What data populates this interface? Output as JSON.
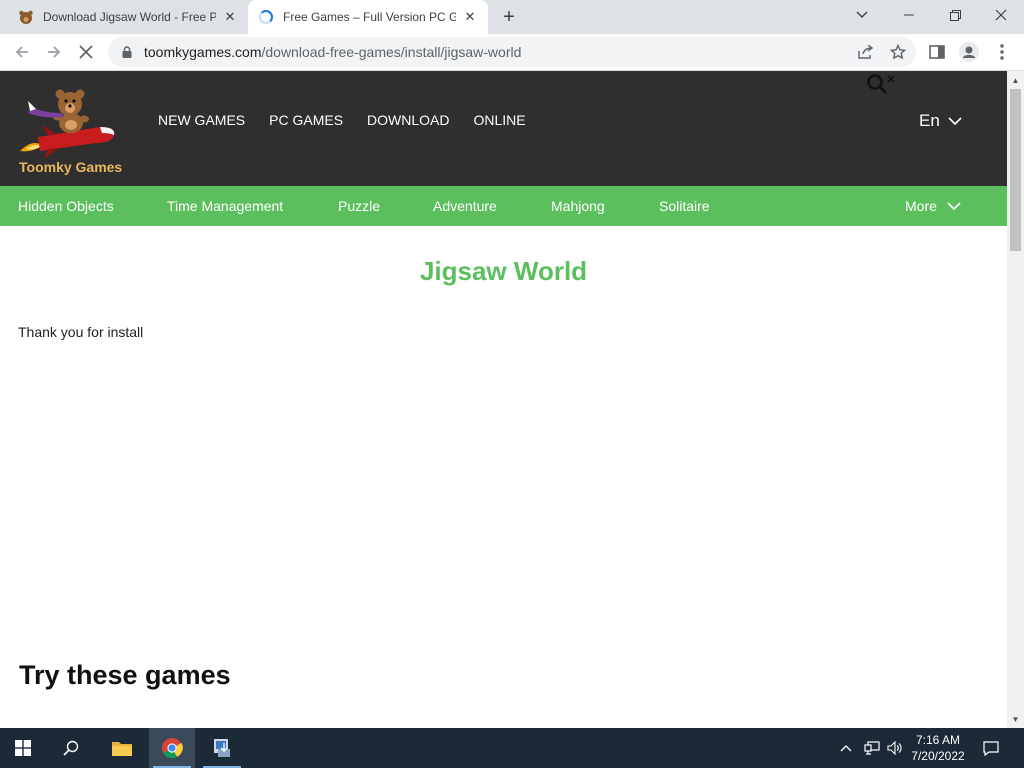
{
  "browser": {
    "tabs": [
      {
        "title": "Download Jigsaw World - Free PC Game",
        "active": false
      },
      {
        "title": "Free Games – Full Version PC Games",
        "active": true
      }
    ],
    "url_host": "toomkygames.com",
    "url_path": "/download-free-games/install/jigsaw-world"
  },
  "site": {
    "logo_text": "Toomky Games",
    "main_nav": [
      "NEW GAMES",
      "PC GAMES",
      "DOWNLOAD",
      "ONLINE"
    ],
    "language": "En",
    "categories": [
      "Hidden Objects",
      "Time Management",
      "Puzzle",
      "Adventure",
      "Mahjong",
      "Solitaire"
    ],
    "more_label": "More"
  },
  "content": {
    "title": "Jigsaw World",
    "message": "Thank you for install",
    "section_heading": "Try these games"
  },
  "taskbar": {
    "time": "7:16 AM",
    "date": "7/20/2022"
  },
  "colors": {
    "accent_green": "#5cbf5d",
    "header_dark": "#2f2f2f",
    "logo_gold": "#e8b85a"
  }
}
